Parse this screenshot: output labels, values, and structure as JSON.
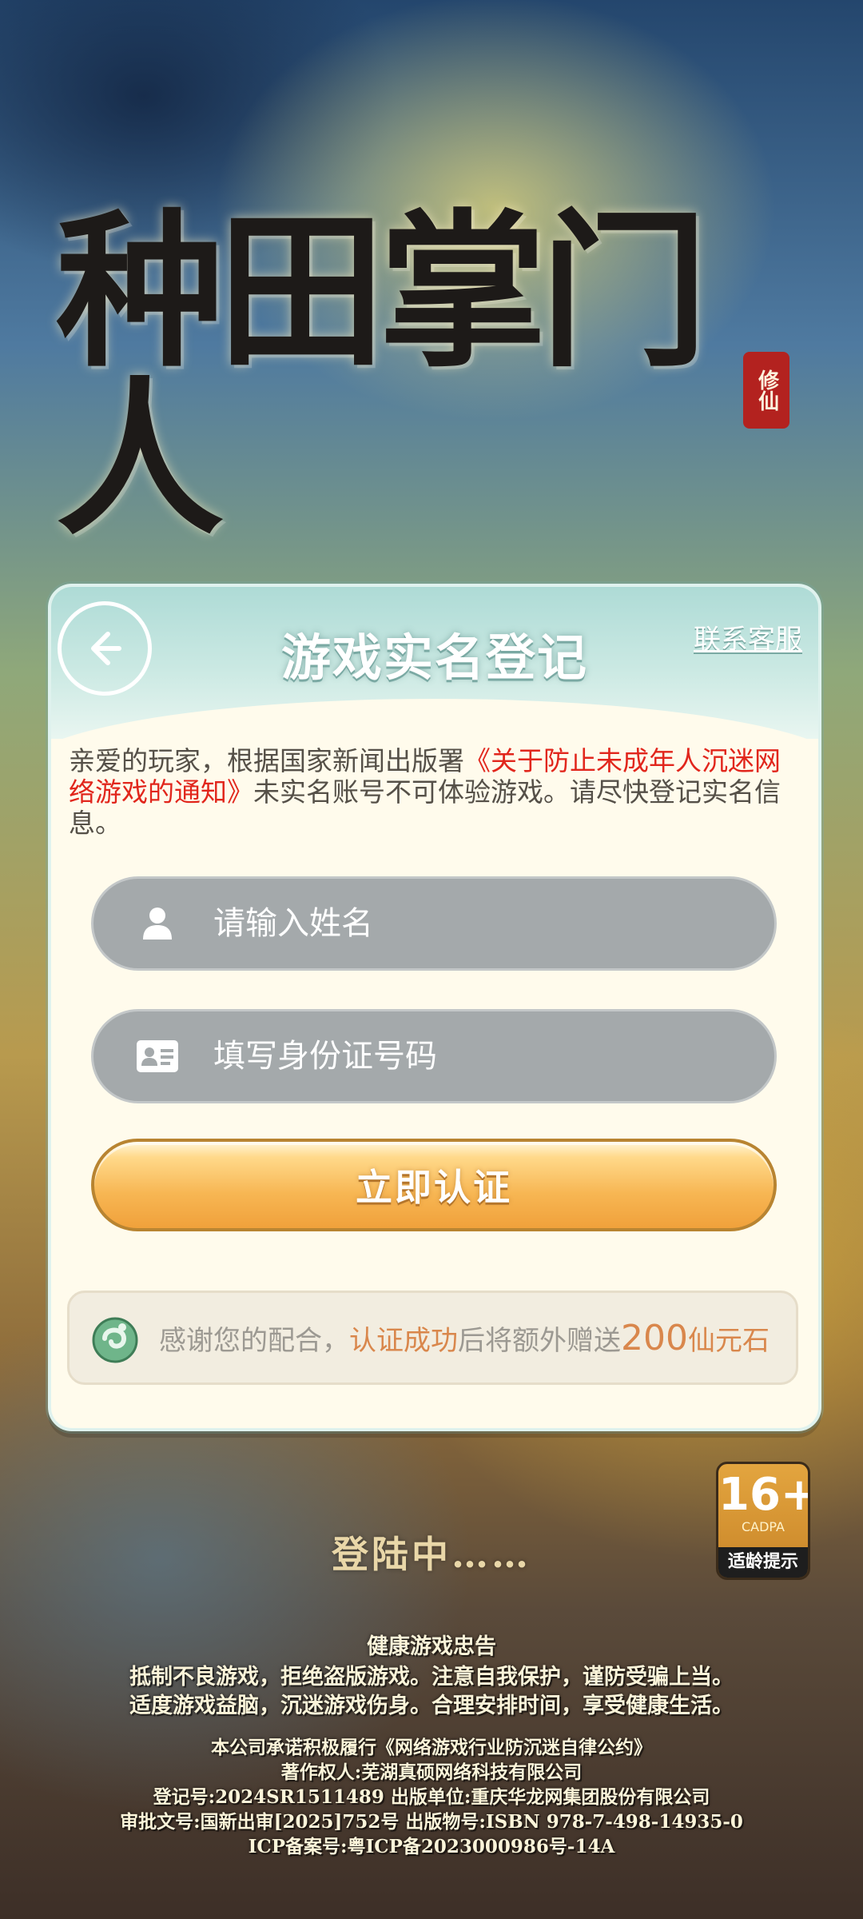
{
  "game": {
    "logo_text": "种田掌门人",
    "logo_seal": "修仙"
  },
  "modal": {
    "title": "游戏实名登记",
    "service_link": "联系客服",
    "notice_prefix": "亲爱的玩家，根据国家新闻出版署",
    "notice_highlight": "《关于防止未成年人沉迷网络游戏的通知》",
    "notice_suffix": "未实名账号不可体验游戏。请尽快登记实名信息。",
    "name_placeholder": "请输入姓名",
    "id_placeholder": "填写身份证号码",
    "verify_button": "立即认证",
    "reward_prefix": "感谢您的配合，",
    "reward_highlight": "认证成功",
    "reward_middle": "后将额外赠送",
    "reward_amount": "200",
    "reward_unit": "仙元石"
  },
  "status": {
    "loading_text": "登陆中……"
  },
  "age_rating": {
    "age": "16+",
    "org": "CADPA",
    "tip": "适龄提示"
  },
  "footer": {
    "health_title": "健康游戏忠告",
    "health_line1": "抵制不良游戏，拒绝盗版游戏。注意自我保护，谨防受骗上当。",
    "health_line2": "适度游戏益脑，沉迷游戏伤身。合理安排时间，享受健康生活。",
    "info_line1": "本公司承诺积极履行《网络游戏行业防沉迷自律公约》",
    "info_line2": "著作权人:芜湖真硕网络科技有限公司",
    "info_line3": "登记号:2024SR1511489 出版单位:重庆华龙网集团股份有限公司",
    "info_line4": "审批文号:国新出审[2025]752号 出版物号:ISBN 978-7-498-14935-0",
    "info_line5": "ICP备案号:粤ICP备2023000986号-14A"
  },
  "colors": {
    "header_teal": "#aedbd6",
    "notice_red": "#e1261c",
    "button_orange": "#f7b653",
    "reward_orange": "#d9874c",
    "field_gray": "#a4a9ab"
  }
}
